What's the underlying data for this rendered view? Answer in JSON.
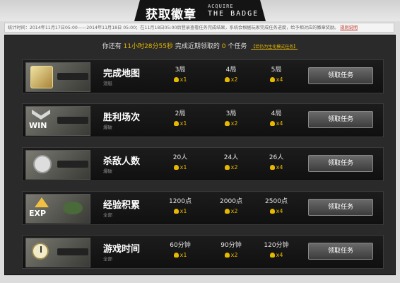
{
  "header": {
    "title_cn": "获取徽章",
    "title_en_line1": "ACQUIRE",
    "title_en_line2": "THE BADGE"
  },
  "notice": {
    "text": "统计时间：2014年11月17日05:00——2014年11月18日 05:00；在11月18日05:00后登录查看任务完成结果，系统会根据玩家完成任务进度，给予相对应的徽章奖励。",
    "link": "规则说明"
  },
  "summary": {
    "prefix": "你还有",
    "time_left": "11小时28分55秒",
    "middle": "完成近期领取的",
    "count": "0",
    "suffix": "个任务",
    "note": "【若仍为生化模式任务】"
  },
  "tasks": [
    {
      "name": "完成地图",
      "sub": "潜艇",
      "tiers": [
        {
          "req": "3局",
          "reward": "x1"
        },
        {
          "req": "4局",
          "reward": "x2"
        },
        {
          "req": "5局",
          "reward": "x4"
        }
      ],
      "button": "领取任务",
      "icon": "gold-map-badge-icon"
    },
    {
      "name": "胜利场次",
      "sub": "爆破",
      "tiers": [
        {
          "req": "2局",
          "reward": "x1"
        },
        {
          "req": "3局",
          "reward": "x2"
        },
        {
          "req": "4局",
          "reward": "x4"
        }
      ],
      "button": "领取任务",
      "icon": "win-badge-icon",
      "badge_text": "WIN"
    },
    {
      "name": "杀敌人数",
      "sub": "爆破",
      "tiers": [
        {
          "req": "20人",
          "reward": "x1"
        },
        {
          "req": "24人",
          "reward": "x2"
        },
        {
          "req": "26人",
          "reward": "x4"
        }
      ],
      "button": "领取任务",
      "icon": "skull-badge-icon"
    },
    {
      "name": "经验积累",
      "sub": "全部",
      "tiers": [
        {
          "req": "1200点",
          "reward": "x1"
        },
        {
          "req": "2000点",
          "reward": "x2"
        },
        {
          "req": "2500点",
          "reward": "x4"
        }
      ],
      "button": "领取任务",
      "icon": "exp-badge-icon",
      "badge_text": "EXP"
    },
    {
      "name": "游戏时间",
      "sub": "全部",
      "tiers": [
        {
          "req": "60分钟",
          "reward": "x1"
        },
        {
          "req": "90分钟",
          "reward": "x2"
        },
        {
          "req": "120分钟",
          "reward": "x4"
        }
      ],
      "button": "领取任务",
      "icon": "clock-badge-icon"
    }
  ],
  "colors": {
    "accent_gold": "#e6b800",
    "panel_bg": "#2a2a2a",
    "link_red": "#c0392b"
  }
}
